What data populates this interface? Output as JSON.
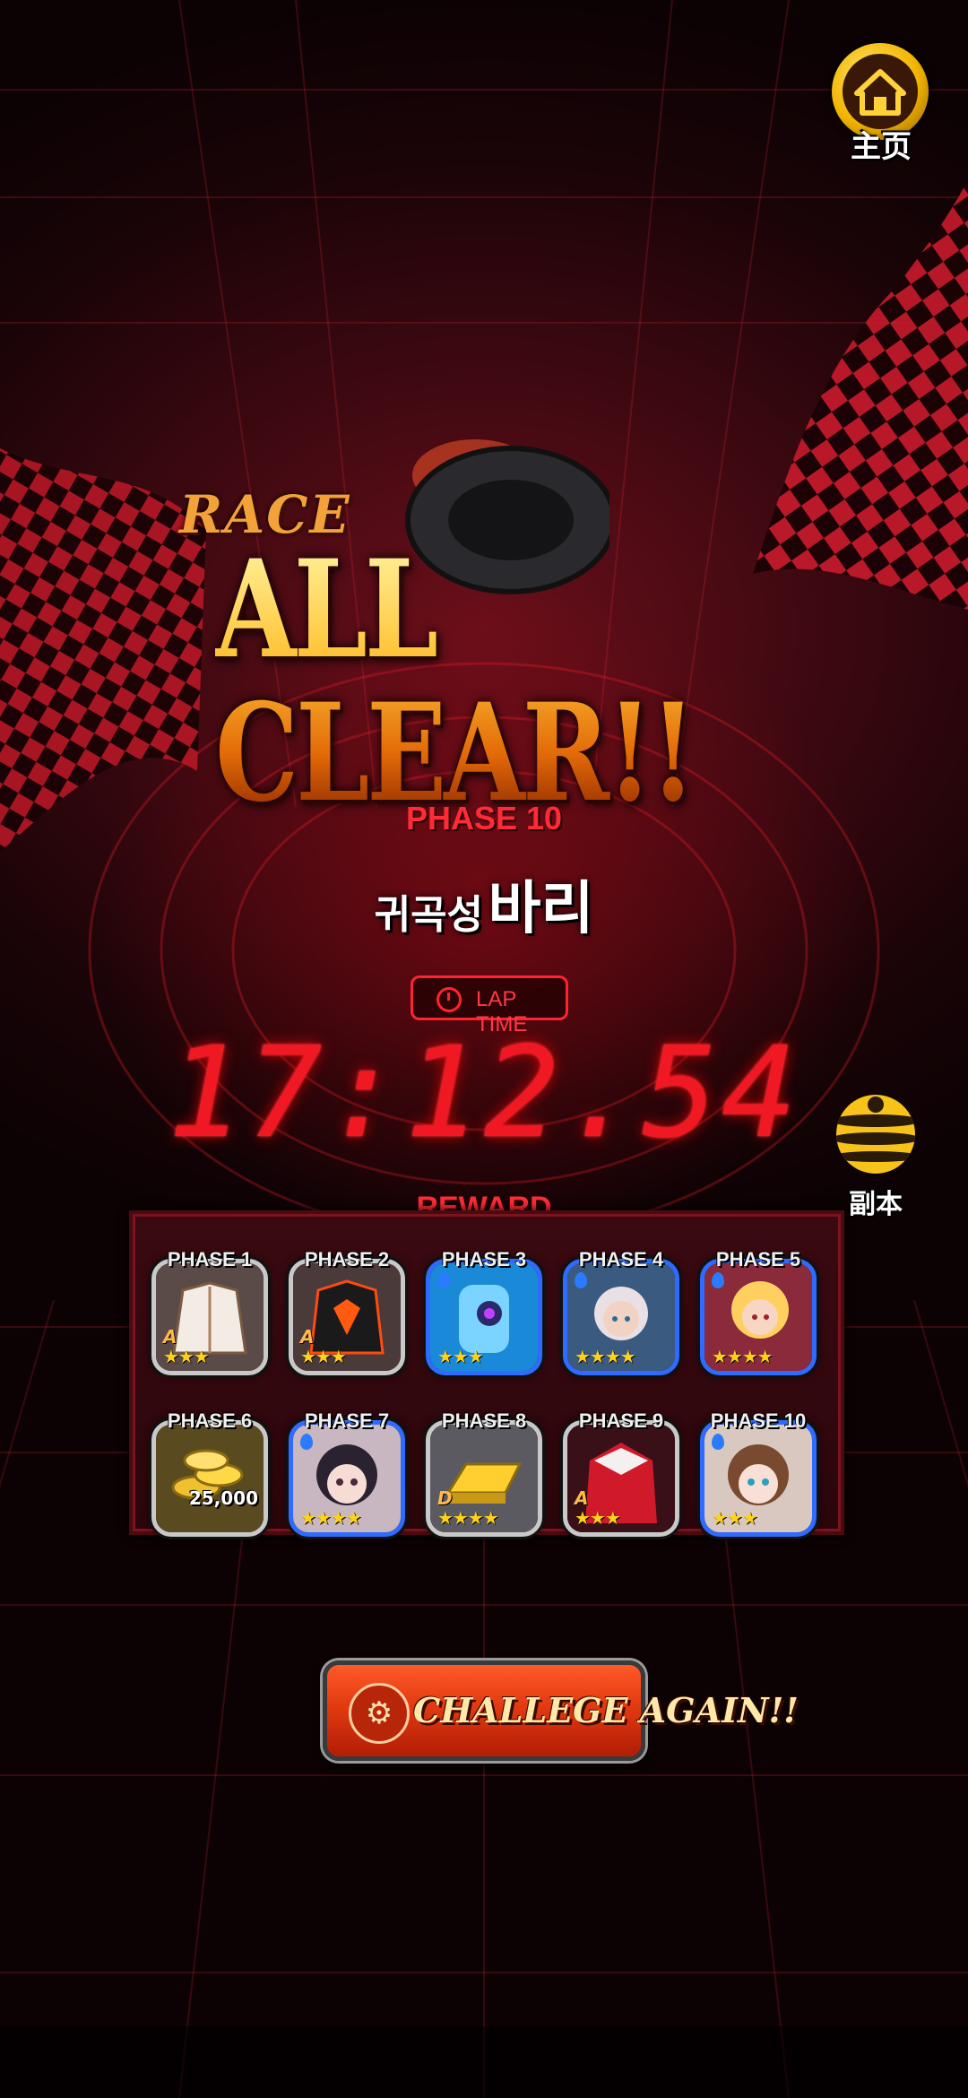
{
  "nav": {
    "home_label": "主页",
    "dungeon_label": "副本"
  },
  "result": {
    "race_label": "RACE",
    "headline": "ALL CLEAR!!",
    "phase": "PHASE 10",
    "boss_prefix": "귀곡성",
    "boss_name": "바리",
    "lap_time_label": "LAP TIME",
    "lap_time_value": "17:12.54"
  },
  "reward": {
    "title": "REWARD",
    "items": [
      {
        "phase": "PHASE 1",
        "icon": "white-jacket-icon",
        "stars": "★★★",
        "grade": "A",
        "frame": "#c9c9c9"
      },
      {
        "phase": "PHASE 2",
        "icon": "black-red-jacket-icon",
        "stars": "★★★",
        "grade": "A",
        "frame": "#c9c9c9"
      },
      {
        "phase": "PHASE 3",
        "icon": "blue-robot-character-icon",
        "stars": "★★★",
        "frame": "#2f6bff"
      },
      {
        "phase": "PHASE 4",
        "icon": "silver-hair-girl-character-icon",
        "stars": "★★★★",
        "frame": "#2f6bff"
      },
      {
        "phase": "PHASE 5",
        "icon": "blonde-girl-character-icon",
        "stars": "★★★★",
        "frame": "#2f6bff"
      },
      {
        "phase": "PHASE 6",
        "icon": "gold-coins-icon",
        "quantity": "25,000",
        "frame": "#c9c9c9"
      },
      {
        "phase": "PHASE 7",
        "icon": "dark-hair-girl-character-icon",
        "stars": "★★★★",
        "frame": "#2f6bff"
      },
      {
        "phase": "PHASE 8",
        "icon": "gold-bar-icon",
        "stars": "★★★★",
        "grade": "D",
        "frame": "#c9c9c9"
      },
      {
        "phase": "PHASE 9",
        "icon": "red-robe-outfit-icon",
        "stars": "★★★",
        "grade": "A",
        "frame": "#c9c9c9"
      },
      {
        "phase": "PHASE 10",
        "icon": "brown-hair-girl-character-icon",
        "stars": "★★★",
        "frame": "#2f6bff"
      }
    ]
  },
  "actions": {
    "challenge_again": "CHALLEGE AGAIN!!"
  },
  "colors": {
    "accent_red": "#ff2b36",
    "gold": "#ffb21e",
    "lap_time_red": "#f01822"
  }
}
